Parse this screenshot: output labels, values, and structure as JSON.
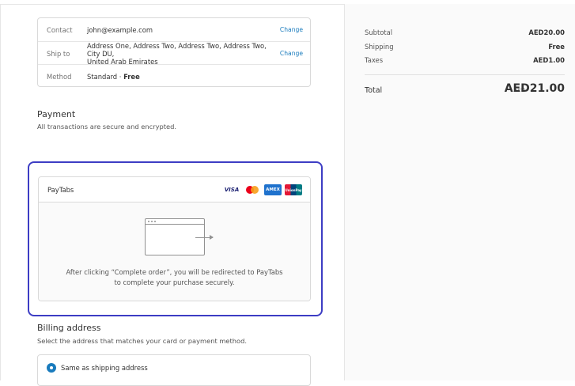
{
  "review": {
    "contact": {
      "label": "Contact",
      "value": "john@example.com",
      "action": "Change"
    },
    "ship": {
      "label": "Ship to",
      "line1": "Address One, Address Two, Address Two, Address Two, City DU,",
      "line2": "United Arab Emirates",
      "action": "Change"
    },
    "method": {
      "label": "Method",
      "value_prefix": "Standard · ",
      "value_bold": "Free"
    }
  },
  "payment": {
    "title": "Payment",
    "subtitle": "All transactions are secure and encrypted.",
    "gateway": "PayTabs",
    "cards": [
      {
        "name": "visa-card-icon",
        "text": "VISA"
      },
      {
        "name": "mastercard-card-icon",
        "text": ""
      },
      {
        "name": "amex-card-icon",
        "text": "AMEX"
      },
      {
        "name": "unionpay-card-icon",
        "text": "UnionPay"
      }
    ],
    "redirect_line1": "After clicking “Complete order”, you will be redirected to PayTabs",
    "redirect_line2": "to complete your purchase securely."
  },
  "billing": {
    "title": "Billing address",
    "subtitle": "Select the address that matches your card or payment method.",
    "option_selected": "Same as shipping address"
  },
  "summary": {
    "subtotal_label": "Subtotal",
    "subtotal_value": "AED20.00",
    "shipping_label": "Shipping",
    "shipping_value": "Free",
    "taxes_label": "Taxes",
    "taxes_value": "AED1.00",
    "total_label": "Total",
    "total_currency": "AED",
    "total_value": "AED21.00"
  },
  "colors": {
    "accent": "#197bbd",
    "highlight": "#3d3dc4"
  }
}
